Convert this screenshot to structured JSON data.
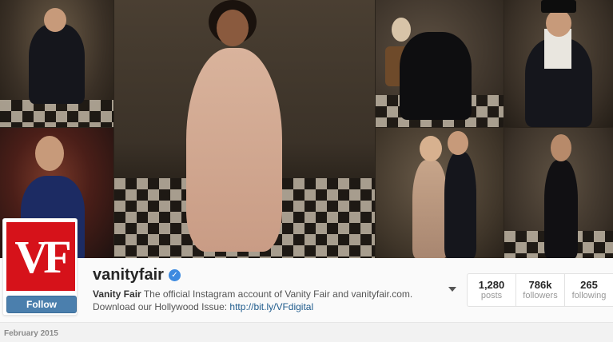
{
  "profile": {
    "username": "vanityfair",
    "logo_text": "VF",
    "follow_label": "Follow",
    "bio_name": "Vanity Fair",
    "bio_text": " The official Instagram account of Vanity Fair and vanityfair.com. Download our Hollywood Issue: ",
    "bio_link": "http://bit.ly/VFdigital"
  },
  "stats": [
    {
      "num": "1,280",
      "label": "posts"
    },
    {
      "num": "786k",
      "label": "followers"
    },
    {
      "num": "265",
      "label": "following"
    }
  ],
  "feed": {
    "month": "February 2015"
  },
  "icons": {
    "verified": "verified-badge-icon",
    "more": "caret-down-icon"
  },
  "colors": {
    "brand_red": "#d6121a",
    "follow_blue": "#4b7fad",
    "verified_blue": "#3d8ae0",
    "link": "#1f5b8c"
  }
}
